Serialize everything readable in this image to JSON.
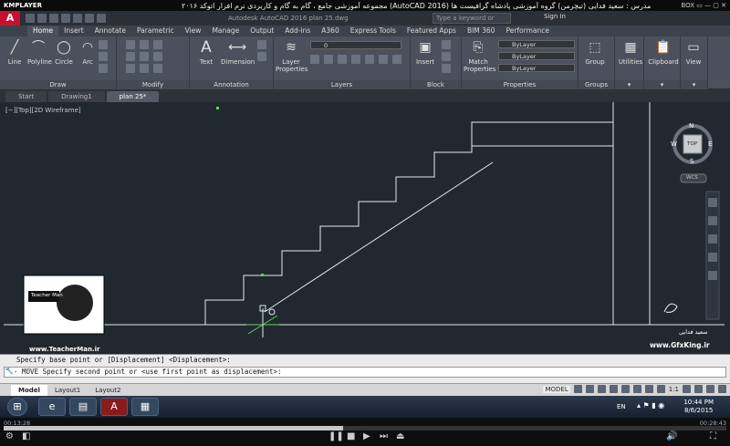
{
  "player": {
    "logo": "KMPLAYER",
    "title": "مجموعه آموزشی جامع ، گام به گام و کاربردی نرم افزار اتوکد ۲۰۱۶ (AutoCAD 2016) مدرس : سعید فدایی (تیچرمن) گروه آموزشی پادشاه گرافیست ها",
    "time_elapsed": "00:13:28",
    "time_total": "00:28:43",
    "progress": 0.47
  },
  "acad": {
    "window_title": "Autodesk AutoCAD 2016  plan 25.dwg",
    "search_placeholder": "Type a keyword or phrase",
    "signin": "Sign In"
  },
  "ribbon_tabs": [
    "Home",
    "Insert",
    "Annotate",
    "Parametric",
    "View",
    "Manage",
    "Output",
    "Add-ins",
    "A360",
    "Express Tools",
    "Featured Apps",
    "BIM 360",
    "Performance"
  ],
  "ribbon": {
    "draw": {
      "title": "Draw",
      "line": "Line",
      "polyline": "Polyline",
      "circle": "Circle",
      "arc": "Arc"
    },
    "modify": {
      "title": "Modify"
    },
    "annotation": {
      "title": "Annotation",
      "text": "Text",
      "dimension": "Dimension"
    },
    "layers": {
      "title": "Layers",
      "layer_properties": "Layer Properties",
      "layer_value": "0"
    },
    "block": {
      "title": "Block",
      "insert": "Insert"
    },
    "properties": {
      "title": "Properties",
      "match": "Match Properties",
      "bylayer1": "ByLayer",
      "bylayer2": "ByLayer",
      "bylayer3": "ByLayer"
    },
    "groups": {
      "title": "Groups",
      "group": "Group"
    },
    "utilities": "Utilities",
    "clipboard": "Clipboard",
    "view": "View"
  },
  "doc_tabs": [
    "Start",
    "Drawing1",
    "plan 25*"
  ],
  "viewport_label": "[−][Top][2D Wireframe]",
  "viewcube": {
    "n": "N",
    "s": "S",
    "e": "E",
    "w": "W",
    "top": "TOP",
    "wcs": "WCS"
  },
  "overlay": {
    "site_left": "www.TeacherMan.ir",
    "site_right": "www.GfxKing.ir",
    "teacher_badge": "Teacher Man",
    "signature": "سعید فدایی"
  },
  "command": {
    "line1": "Specify base point or [Displacement] <Displacement>:",
    "line2": "- MOVE Specify second point or <use first point as displacement>:"
  },
  "layout_tabs": [
    "Model",
    "Layout1",
    "Layout2"
  ],
  "status": {
    "model": "MODEL",
    "scale": "1:1"
  },
  "taskbar": {
    "lang": "EN",
    "time": "10:44 PM",
    "date": "8/6/2015"
  }
}
